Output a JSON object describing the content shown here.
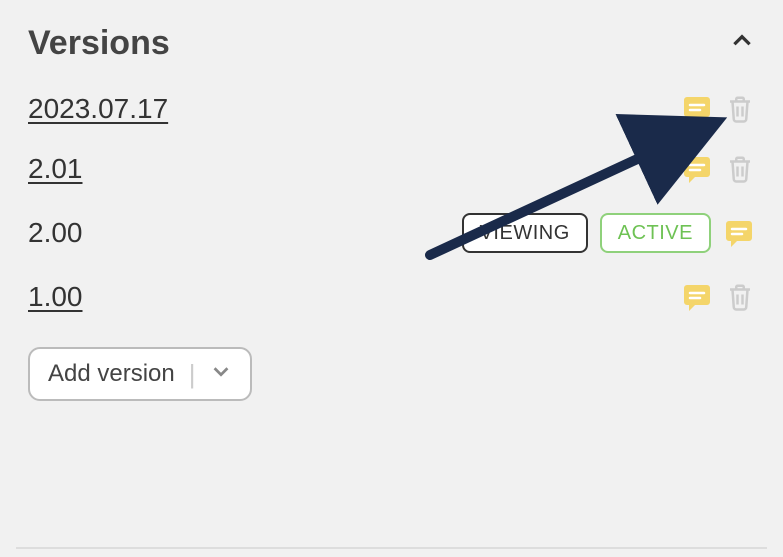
{
  "panel": {
    "title": "Versions"
  },
  "versions": [
    {
      "label": "2023.07.17",
      "linked": true,
      "viewing": false,
      "active": false,
      "has_comment": true,
      "has_trash": true
    },
    {
      "label": "2.01",
      "linked": true,
      "viewing": false,
      "active": false,
      "has_comment": true,
      "has_trash": true
    },
    {
      "label": "2.00",
      "linked": false,
      "viewing": true,
      "active": true,
      "has_comment": true,
      "has_trash": false
    },
    {
      "label": "1.00",
      "linked": true,
      "viewing": false,
      "active": false,
      "has_comment": true,
      "has_trash": true
    }
  ],
  "badges": {
    "viewing": "VIEWING",
    "active": "ACTIVE"
  },
  "buttons": {
    "add_version": "Add version"
  },
  "colors": {
    "comment_icon_bg": "#f4d56a",
    "comment_icon_fg": "#ffffff",
    "active_border": "#8fd17b",
    "active_text": "#6ec254",
    "arrow": "#1a2a4a"
  }
}
